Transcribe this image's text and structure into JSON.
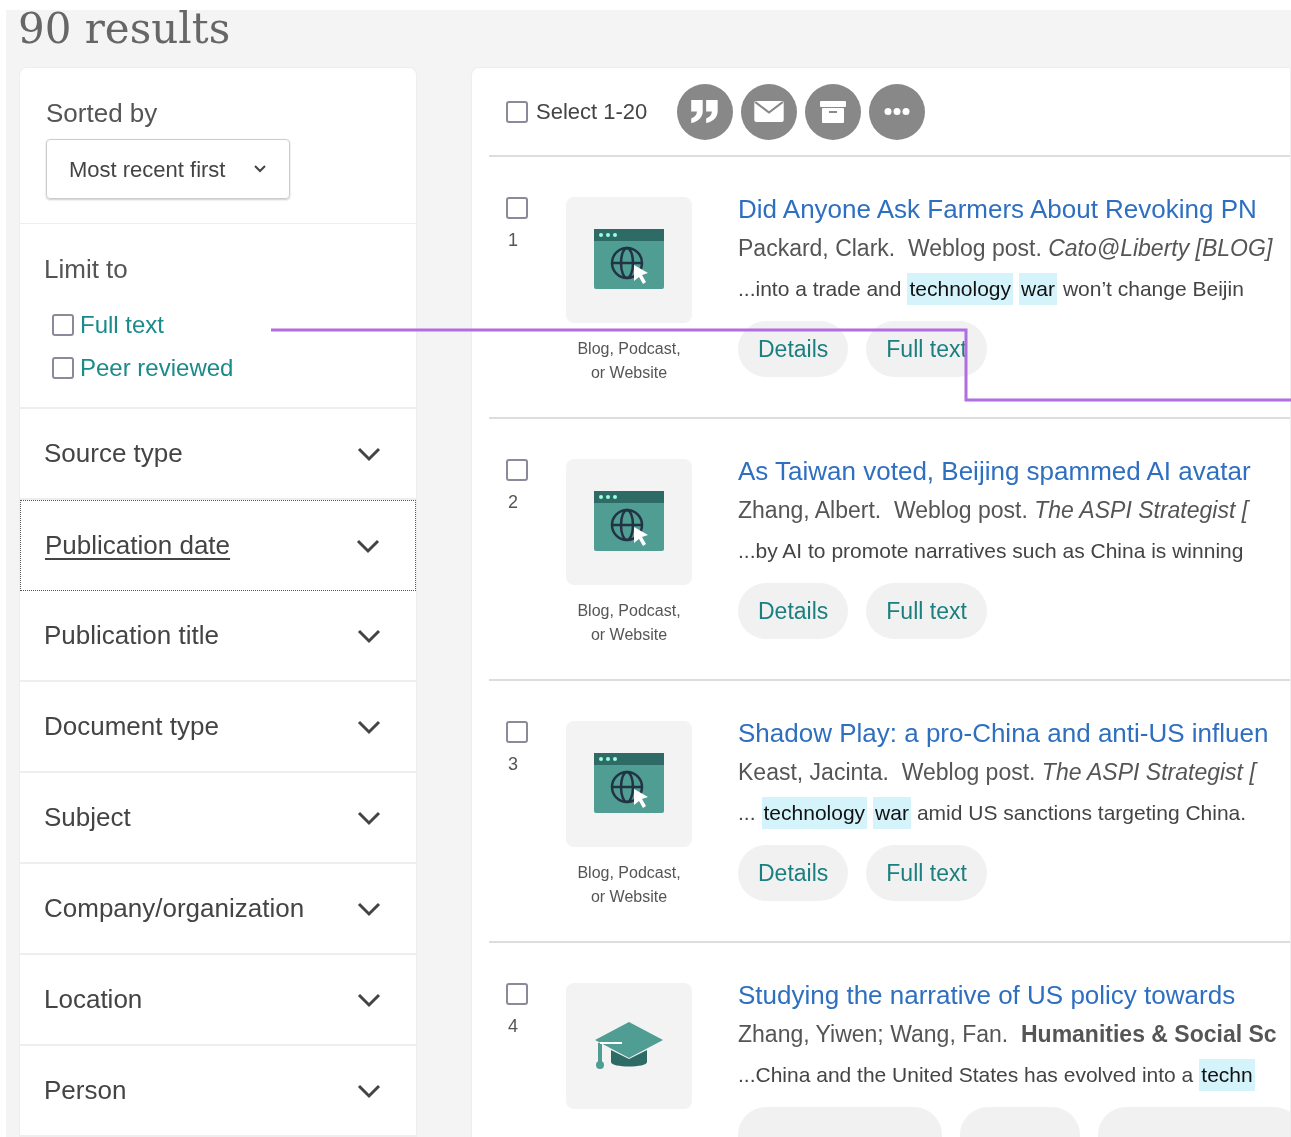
{
  "results_count": "90 results",
  "sort": {
    "label": "Sorted by",
    "value": "Most recent first"
  },
  "limit": {
    "title": "Limit to",
    "options": [
      {
        "label": "Full text",
        "checked": false
      },
      {
        "label": "Peer reviewed",
        "checked": false
      }
    ]
  },
  "facets": [
    {
      "label": "Source type",
      "focused": false
    },
    {
      "label": "Publication date",
      "focused": true
    },
    {
      "label": "Publication title",
      "focused": false
    },
    {
      "label": "Document type",
      "focused": false
    },
    {
      "label": "Subject",
      "focused": false
    },
    {
      "label": "Company/organization",
      "focused": false
    },
    {
      "label": "Location",
      "focused": false
    },
    {
      "label": "Person",
      "focused": false
    }
  ],
  "toolbar": {
    "select_label": "Select 1-20",
    "select_checked": false,
    "actions": [
      {
        "kind": "quote"
      },
      {
        "kind": "email"
      },
      {
        "kind": "archive"
      },
      {
        "kind": "more"
      }
    ]
  },
  "results": [
    {
      "number": "1",
      "checked": false,
      "kind": "web",
      "source_type": "Blog, Podcast, or Website",
      "title": "Did Anyone Ask Farmers About Revoking PN",
      "meta": "Packard, Clark.  Weblog post. *Cato@Liberty [BLOG]*",
      "snippet": [
        {
          "text": "...into a trade and",
          "highlight": false
        },
        {
          "text": "technology",
          "highlight": true
        },
        {
          "text": "war",
          "highlight": true
        },
        {
          "text": "won’t change Beijin",
          "highlight": false
        }
      ],
      "buttons": [
        "Details",
        "Full text"
      ]
    },
    {
      "number": "2",
      "checked": false,
      "kind": "web",
      "source_type": "Blog, Podcast, or Website",
      "title": "As Taiwan voted, Beijing spammed AI avatar",
      "meta": "Zhang, Albert.  Weblog post. *The ASPI Strategist [*",
      "snippet": [
        {
          "text": "...by AI to promote narratives such as China is winning",
          "highlight": false
        }
      ],
      "buttons": [
        "Details",
        "Full text"
      ]
    },
    {
      "number": "3",
      "checked": false,
      "kind": "web",
      "source_type": "Blog, Podcast, or Website",
      "title": "Shadow Play: a pro-China and anti-US influen",
      "meta": "Keast, Jacinta.  Weblog post. *The ASPI Strategist [*",
      "snippet": [
        {
          "text": "...",
          "highlight": false
        },
        {
          "text": "technology",
          "highlight": true
        },
        {
          "text": "war",
          "highlight": true
        },
        {
          "text": "amid US sanctions targeting China.",
          "highlight": false
        }
      ],
      "buttons": [
        "Details",
        "Full text"
      ]
    },
    {
      "number": "4",
      "checked": false,
      "kind": "scholarly",
      "title": "Studying the narrative of US policy towards",
      "meta": "Zhang, Yiwen; Wang, Fan.  **Humanities & Social Sc**",
      "snippet": [
        {
          "text": "...China and the United States has evolved into a",
          "highlight": false
        },
        {
          "text": "techn",
          "highlight": true
        }
      ],
      "cut_buttons": [
        {
          "kind": "wide"
        },
        {
          "kind": "narrow"
        },
        {
          "kind": "wide"
        }
      ]
    }
  ]
}
